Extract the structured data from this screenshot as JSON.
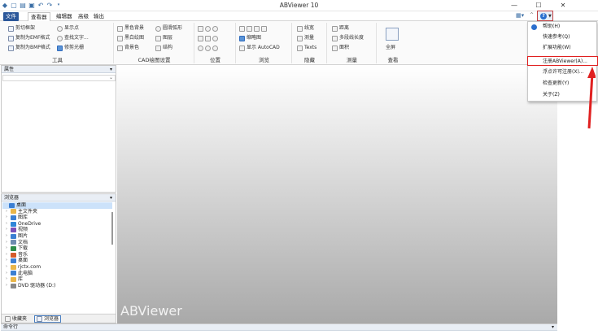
{
  "app": {
    "title": "ABViewer 10"
  },
  "window": {
    "minimize": "—",
    "maximize": "☐",
    "close": "✕"
  },
  "tabs": [
    "文件",
    "查看器",
    "编辑器",
    "高级",
    "输出"
  ],
  "ribbon": {
    "groups": [
      {
        "label": "工具",
        "items": [
          "剪切框架",
          "显示点",
          "复制为EMF格式",
          "查找文字...",
          "复制为BMP格式",
          "修剪光栅"
        ]
      },
      {
        "label": "CAD绘图设置",
        "items": [
          "黑色背景",
          "圆滑弧形",
          "黑白绘图",
          "图层",
          "背景色",
          "结构"
        ]
      },
      {
        "label": "位置",
        "items": []
      },
      {
        "label": "浏览",
        "items": [
          "线宽",
          "缩略图",
          "显示 AutoCAD"
        ]
      },
      {
        "label": "隐藏",
        "items": [
          "测量",
          "Texts"
        ]
      },
      {
        "label": "测量",
        "items": [
          "距离",
          "多段线长度",
          "面积"
        ]
      },
      {
        "label": "查看",
        "items": [
          "全屏"
        ]
      }
    ]
  },
  "help_menu": {
    "items": [
      "帮助(H)",
      "快速参考(Q)",
      "扩展功能(W)",
      "注册ABViewer(A)...",
      "浮点许可注册(X)...",
      "检查更新(Y)",
      "关于(Z)"
    ],
    "highlight_index": 3
  },
  "panels": {
    "properties_title": "属性",
    "browser_title": "浏览器",
    "command_title": "命令行",
    "browser_tabs": [
      "收藏夹",
      "浏览器"
    ]
  },
  "tree": [
    {
      "label": "桌面",
      "level": 0,
      "color": "#3b7fd3",
      "selected": true
    },
    {
      "label": "主文件夹",
      "level": 1,
      "color": "#e9b64a"
    },
    {
      "label": "图库",
      "level": 1,
      "color": "#3b7fd3"
    },
    {
      "label": "OneDrive",
      "level": 1,
      "color": "#2f86d8"
    },
    {
      "label": "视频",
      "level": 1,
      "color": "#7a4fb8"
    },
    {
      "label": "图片",
      "level": 1,
      "color": "#3b7fd3"
    },
    {
      "label": "文档",
      "level": 1,
      "color": "#6e8bb0"
    },
    {
      "label": "下载",
      "level": 1,
      "color": "#2e8d4a"
    },
    {
      "label": "音乐",
      "level": 1,
      "color": "#d45b2a"
    },
    {
      "label": "桌面",
      "level": 1,
      "color": "#3b7fd3"
    },
    {
      "label": "rjctx.com",
      "level": 1,
      "color": "#e9b64a"
    },
    {
      "label": "此电脑",
      "level": 1,
      "color": "#3b7fd3"
    },
    {
      "label": "库",
      "level": 1,
      "color": "#e9b64a"
    },
    {
      "label": "DVD 驱动器 (D:)",
      "level": 1,
      "color": "#888888"
    }
  ],
  "canvas": {
    "watermark": "ABViewer"
  }
}
